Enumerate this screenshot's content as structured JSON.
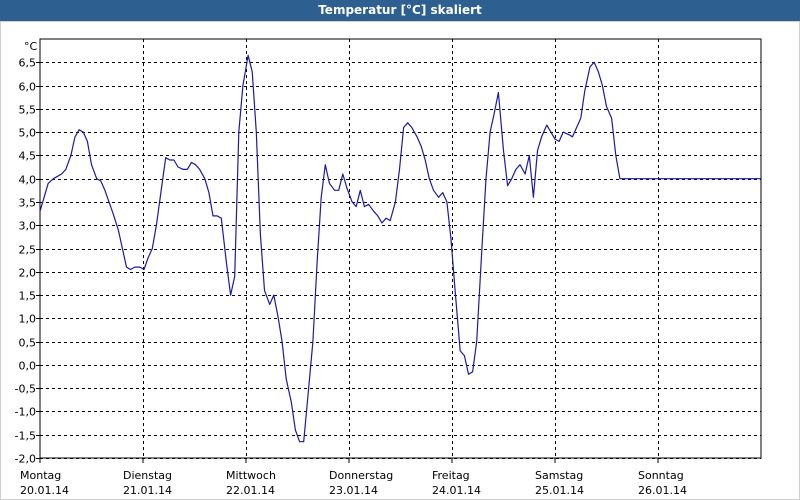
{
  "window": {
    "title": "Temperatur [°C] skaliert"
  },
  "colors": {
    "titlebar": "#2d5f91",
    "series": "#1a1aa6",
    "grid": "#000000"
  },
  "chart_data": {
    "type": "line",
    "title": "Temperatur [°C] skaliert",
    "ylabel": "°C",
    "xlabel": "",
    "ylim": [
      -2.0,
      7.0
    ],
    "xlim": [
      0,
      7
    ],
    "yticks": [
      "-2,0",
      "-1,5",
      "-1,0",
      "-0,5",
      "0,0",
      "0,5",
      "1,0",
      "1,5",
      "2,0",
      "2,5",
      "3,0",
      "3,5",
      "4,0",
      "4,5",
      "5,0",
      "5,5",
      "6,0",
      "6,5"
    ],
    "ytick_values": [
      -2.0,
      -1.5,
      -1.0,
      -0.5,
      0.0,
      0.5,
      1.0,
      1.5,
      2.0,
      2.5,
      3.0,
      3.5,
      4.0,
      4.5,
      5.0,
      5.5,
      6.0,
      6.5
    ],
    "xticks": [
      {
        "day": "Montag",
        "date": "20.01.14"
      },
      {
        "day": "Dienstag",
        "date": "21.01.14"
      },
      {
        "day": "Mittwoch",
        "date": "22.01.14"
      },
      {
        "day": "Donnerstag",
        "date": "23.01.14"
      },
      {
        "day": "Freitag",
        "date": "24.01.14"
      },
      {
        "day": "Samstag",
        "date": "25.01.14"
      },
      {
        "day": "Sonntag",
        "date": "26.01.14"
      }
    ],
    "grid": true,
    "series": [
      {
        "x": [
          0,
          0.04,
          0.08,
          0.13,
          0.17,
          0.21,
          0.25,
          0.3,
          0.34,
          0.38,
          0.42,
          0.46,
          0.5,
          0.55,
          0.59,
          0.63,
          0.67,
          0.71,
          0.76,
          0.8,
          0.84,
          0.88,
          0.92,
          0.97,
          1.01,
          1.05,
          1.09,
          1.13,
          1.18,
          1.22,
          1.26,
          1.3,
          1.34,
          1.39,
          1.43,
          1.47,
          1.51,
          1.55,
          1.6,
          1.64,
          1.68,
          1.72,
          1.76,
          1.81,
          1.85,
          1.89,
          1.93,
          1.97,
          2.02,
          2.06,
          2.1,
          2.14,
          2.18,
          2.23,
          2.27,
          2.31,
          2.35,
          2.39,
          2.44,
          2.48,
          2.52,
          2.56,
          2.6,
          2.65,
          2.69,
          2.73,
          2.77,
          2.81,
          2.86,
          2.9,
          2.94,
          2.98,
          3.03,
          3.07,
          3.11,
          3.15,
          3.19,
          3.24,
          3.28,
          3.32,
          3.36,
          3.4,
          3.45,
          3.49,
          3.53,
          3.57,
          3.61,
          3.66,
          3.7,
          3.74,
          3.78,
          3.82,
          3.87,
          3.91,
          3.95,
          3.99,
          4.03,
          4.08,
          4.12,
          4.16,
          4.2,
          4.24,
          4.29,
          4.33,
          4.37,
          4.41,
          4.45,
          4.5,
          4.54,
          4.58,
          4.62,
          4.66,
          4.71,
          4.75,
          4.79,
          4.83,
          4.87,
          4.92,
          4.96,
          5.0,
          5.04,
          5.08,
          5.13,
          5.17,
          5.21,
          5.25,
          5.29,
          5.34,
          5.38,
          5.42,
          5.46,
          5.5,
          5.55,
          5.59,
          5.63,
          5.67,
          5.71,
          5.76,
          5.8,
          5.84,
          5.88,
          5.92,
          5.97,
          6.01,
          6.05,
          6.09,
          6.13,
          6.18,
          6.22,
          6.26,
          6.3,
          6.34,
          6.39,
          6.43,
          6.47,
          6.51,
          6.55,
          6.6,
          6.64,
          6.68,
          6.72,
          6.76,
          6.81,
          6.85,
          6.89,
          6.93,
          6.97,
          7.0
        ],
        "y": [
          3.3,
          3.6,
          3.9,
          4.0,
          4.05,
          4.1,
          4.2,
          4.5,
          4.9,
          5.05,
          5.0,
          4.8,
          4.3,
          4.0,
          3.95,
          3.75,
          3.5,
          3.25,
          2.9,
          2.5,
          2.1,
          2.05,
          2.1,
          2.1,
          2.05,
          2.3,
          2.5,
          3.0,
          3.8,
          4.45,
          4.4,
          4.4,
          4.25,
          4.2,
          4.2,
          4.35,
          4.3,
          4.2,
          4.0,
          3.7,
          3.2,
          3.2,
          3.15,
          2.2,
          1.5,
          1.9,
          5.0,
          6.0,
          6.65,
          6.3,
          5.0,
          2.8,
          1.6,
          1.3,
          1.5,
          1.05,
          0.5,
          -0.3,
          -0.8,
          -1.4,
          -1.65,
          -1.65,
          -0.7,
          0.5,
          2.2,
          3.6,
          4.3,
          3.9,
          3.75,
          3.75,
          4.1,
          3.8,
          3.5,
          3.4,
          3.75,
          3.4,
          3.45,
          3.3,
          3.2,
          3.05,
          3.15,
          3.1,
          3.5,
          4.2,
          5.1,
          5.2,
          5.1,
          4.9,
          4.7,
          4.4,
          4.0,
          3.75,
          3.6,
          3.7,
          3.5,
          2.7,
          1.6,
          0.3,
          0.2,
          -0.2,
          -0.15,
          0.5,
          2.5,
          4.0,
          5.0,
          5.4,
          5.85,
          4.6,
          3.85,
          4.0,
          4.2,
          4.3,
          4.1,
          4.5,
          3.6,
          4.6,
          4.9,
          5.15,
          5.0,
          4.85,
          4.8,
          5.0,
          4.95,
          4.9,
          5.1,
          5.3,
          5.9,
          6.4,
          6.5,
          6.3,
          6.0,
          5.55,
          5.3,
          4.5,
          4.0,
          4.0,
          4.0,
          4.0,
          4.0,
          4.0,
          4.0,
          4.0,
          4.0,
          4.0,
          4.0,
          4.0,
          4.0,
          4.0,
          4.0,
          4.0,
          4.0,
          4.0,
          4.0,
          4.0,
          4.0,
          4.0,
          4.0,
          4.0,
          4.0,
          4.0,
          4.0,
          4.0,
          4.0,
          4.0,
          4.0,
          4.0,
          4.0,
          4.0
        ]
      }
    ]
  }
}
